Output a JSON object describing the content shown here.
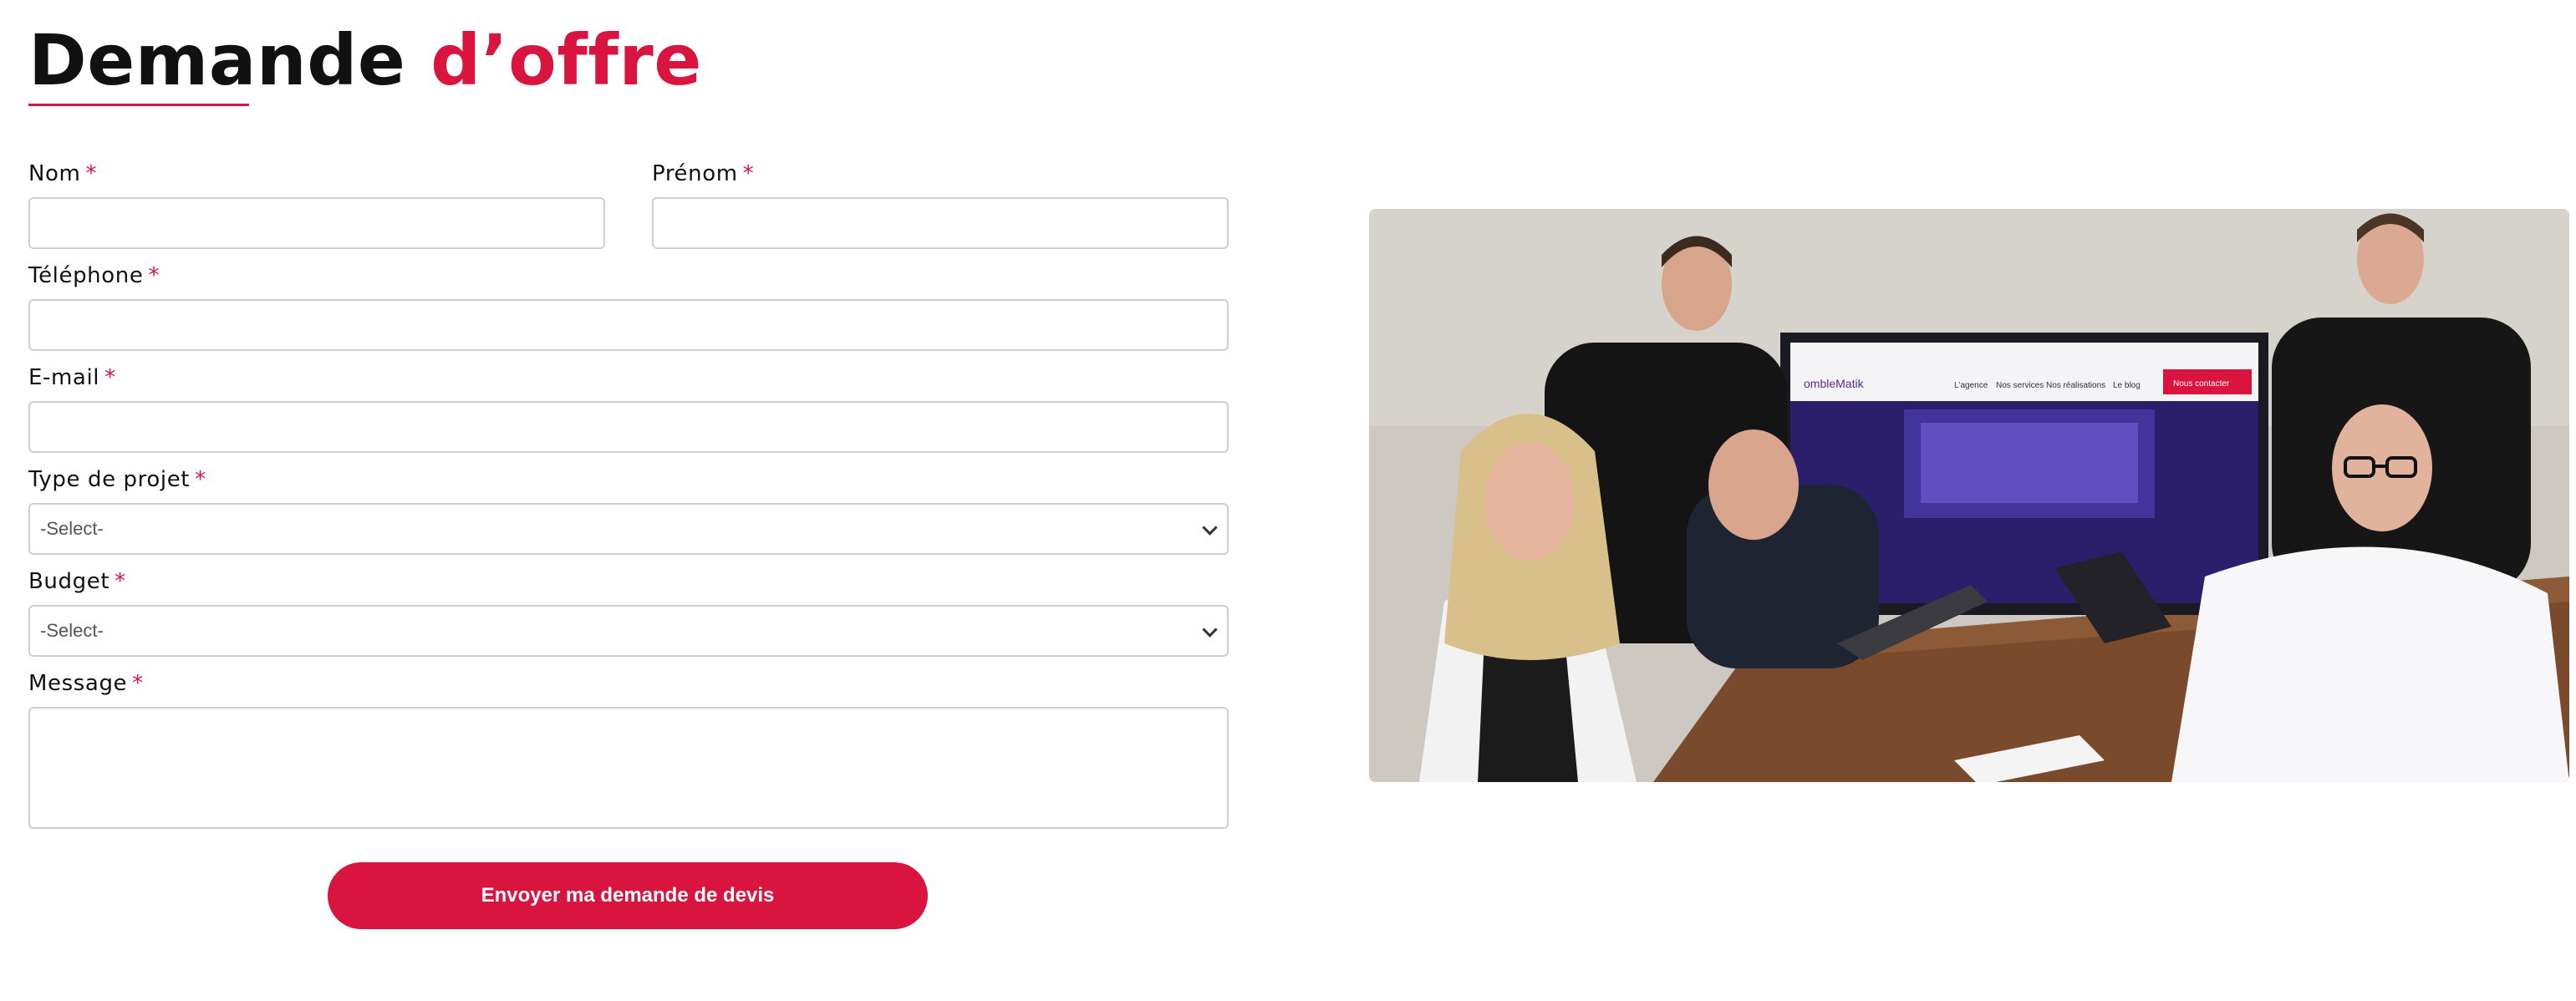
{
  "heading": {
    "part1": "Demande",
    "part2": "d’offre"
  },
  "form": {
    "required_mark": "*",
    "fields": {
      "nom": {
        "label": "Nom",
        "value": ""
      },
      "prenom": {
        "label": "Prénom",
        "value": ""
      },
      "telephone": {
        "label": "Téléphone",
        "value": ""
      },
      "email": {
        "label": "E-mail",
        "value": ""
      },
      "type_projet": {
        "label": "Type de projet",
        "selected": "-Select-"
      },
      "budget": {
        "label": "Budget",
        "selected": "-Select-"
      },
      "message": {
        "label": "Message",
        "value": ""
      }
    },
    "submit_label": "Envoyer ma demande de devis"
  },
  "photo": {
    "screen_site": {
      "logo": "ombleMatik",
      "nav": [
        "L'agence",
        "Nos services",
        "Nos réalisations",
        "Le blog"
      ],
      "cta": "Nous contacter"
    }
  },
  "colors": {
    "accent": "#d8143f",
    "border": "#cfcfcf",
    "text": "#111111"
  },
  "icons": {
    "select_arrow": "chevron-down-icon"
  }
}
